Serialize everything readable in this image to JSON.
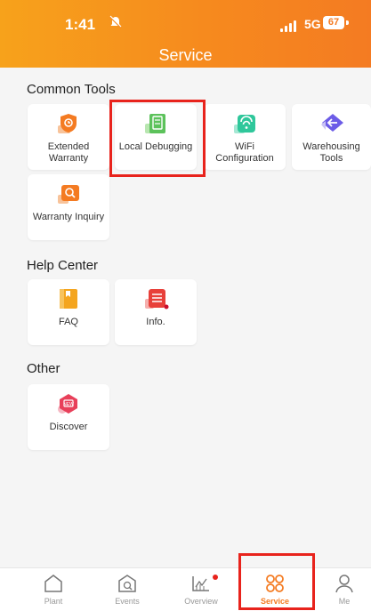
{
  "status": {
    "time": "1:41",
    "network": "5G",
    "battery": "67"
  },
  "header": {
    "title": "Service"
  },
  "sections": {
    "common_tools": {
      "title": "Common Tools",
      "items": [
        {
          "label": "Extended Warranty",
          "icon": "extended-warranty-icon",
          "color": "#f47b22"
        },
        {
          "label": "Local Debugging",
          "icon": "local-debugging-icon",
          "color": "#5cc25b"
        },
        {
          "label": "WiFi Configuration",
          "icon": "wifi-icon",
          "color": "#2fc79b"
        },
        {
          "label": "Warehousing Tools",
          "icon": "warehousing-icon",
          "color": "#6c5ce7"
        },
        {
          "label": "Warranty Inquiry",
          "icon": "warranty-inquiry-icon",
          "color": "#f47b22"
        }
      ]
    },
    "help_center": {
      "title": "Help Center",
      "items": [
        {
          "label": "FAQ",
          "icon": "faq-icon",
          "color": "#f4a51f"
        },
        {
          "label": "Info.",
          "icon": "info-icon",
          "color": "#e8403a"
        }
      ]
    },
    "other": {
      "title": "Other",
      "items": [
        {
          "label": "Discover",
          "icon": "discover-icon",
          "color": "#e8405a"
        }
      ]
    }
  },
  "tabbar": {
    "items": [
      {
        "label": "Plant",
        "icon": "home-icon"
      },
      {
        "label": "Events",
        "icon": "events-icon"
      },
      {
        "label": "Overview",
        "icon": "overview-icon"
      },
      {
        "label": "Service",
        "icon": "service-icon",
        "active": true
      },
      {
        "label": "Me",
        "icon": "user-icon"
      }
    ]
  },
  "colors": {
    "accent": "#f47b22",
    "highlight": "#e8231c"
  }
}
